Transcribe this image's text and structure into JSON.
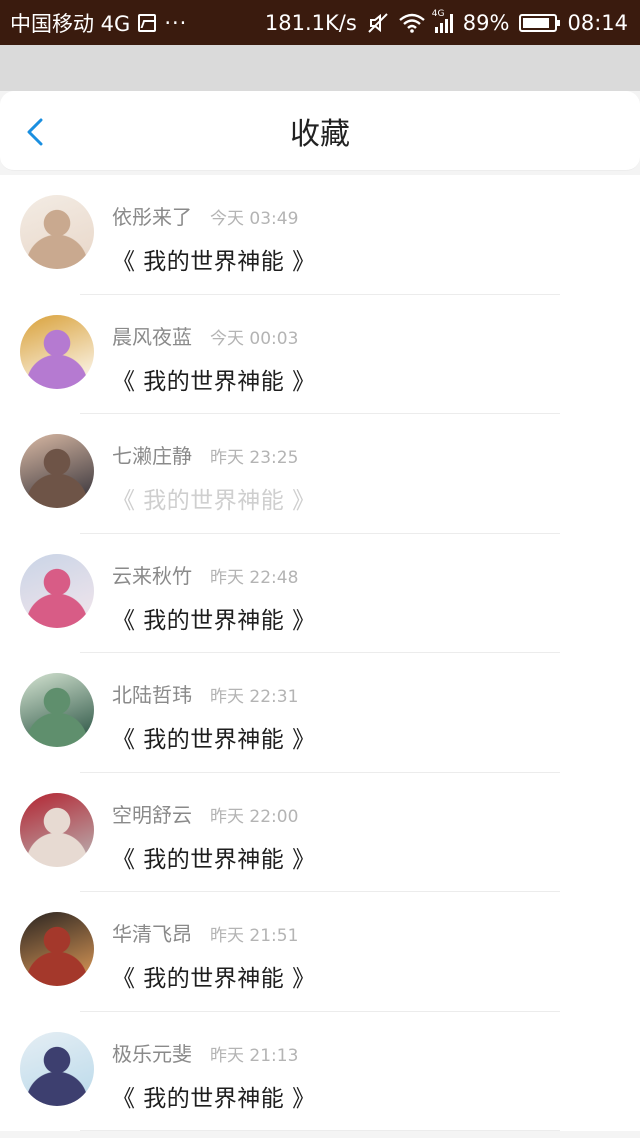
{
  "status_bar": {
    "carrier": "中国移动 4G",
    "more": "···",
    "speed": "181.1K/s",
    "network_badge": "4G",
    "battery": "89%",
    "time": "08:14"
  },
  "header": {
    "title": "收藏"
  },
  "favorites": [
    {
      "author": "依彤来了",
      "time": "今天 03:49",
      "title": "《 我的世界神能 》",
      "faded": false,
      "avatar_colors": [
        "#e8d6c8",
        "#c9a98f",
        "#f3ece4"
      ]
    },
    {
      "author": "晨风夜蓝",
      "time": "今天 00:03",
      "title": "《 我的世界神能 》",
      "faded": false,
      "avatar_colors": [
        "#ffffff",
        "#b57ad1",
        "#d9a13a"
      ]
    },
    {
      "author": "七濑庄静",
      "time": "昨天 23:25",
      "title": "《 我的世界神能 》",
      "faded": true,
      "avatar_colors": [
        "#2b2a33",
        "#6e5447",
        "#d9b9a4"
      ]
    },
    {
      "author": "云来秋竹",
      "time": "昨天 22:48",
      "title": "《 我的世界神能 》",
      "faded": false,
      "avatar_colors": [
        "#f4e6ec",
        "#d85c86",
        "#c9d4e6"
      ]
    },
    {
      "author": "北陆哲玮",
      "time": "昨天 22:31",
      "title": "《 我的世界神能 》",
      "faded": false,
      "avatar_colors": [
        "#1f4a3a",
        "#5f8f6d",
        "#d5e4d2"
      ]
    },
    {
      "author": "空明舒云",
      "time": "昨天 22:00",
      "title": "《 我的世界神能 》",
      "faded": false,
      "avatar_colors": [
        "#b9b9b9",
        "#e7dad2",
        "#b32431"
      ]
    },
    {
      "author": "华清飞昂",
      "time": "昨天 21:51",
      "title": "《 我的世界神能 》",
      "faded": false,
      "avatar_colors": [
        "#e6a05a",
        "#a4382b",
        "#2a2421"
      ]
    },
    {
      "author": "极乐元斐",
      "time": "昨天 21:13",
      "title": "《 我的世界神能 》",
      "faded": false,
      "avatar_colors": [
        "#b9d9ea",
        "#3d3f6f",
        "#e5eef4"
      ]
    }
  ],
  "colors": {
    "accent": "#1a8fe0",
    "status_bar": "#3a1b0e"
  }
}
